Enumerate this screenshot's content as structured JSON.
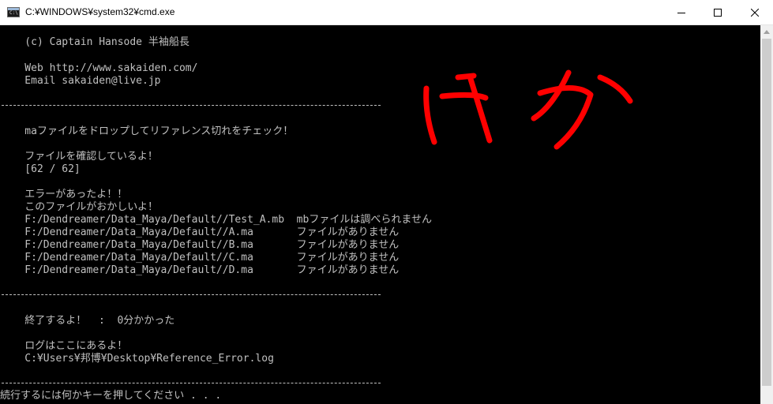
{
  "window": {
    "title": "C:¥WINDOWS¥system32¥cmd.exe",
    "icon_text": "C:\\",
    "icon": "console-icon",
    "controls": {
      "minimize": "minimize-icon",
      "maximize": "maximize-icon",
      "close": "close-icon"
    }
  },
  "console": {
    "lines": [
      "    (c) Captain Hansode 半袖船長",
      "",
      "    Web http://www.sakaiden.com/",
      "    Email sakaiden@live.jp",
      "    maファイルをドロップしてリファレンス切れをチェック！",
      "    ファイルを確認しているよ！",
      "    [62 / 62]",
      "    エラーがあったよ！！",
      "    このファイルがおかしいよ！",
      "    F:/Dendreamer/Data_Maya/Default//Test_A.mb  mbファイルは調べられません",
      "    F:/Dendreamer/Data_Maya/Default//A.ma       ファイルがありません",
      "    F:/Dendreamer/Data_Maya/Default//B.ma       ファイルがありません",
      "    F:/Dendreamer/Data_Maya/Default//C.ma       ファイルがありません",
      "    F:/Dendreamer/Data_Maya/Default//D.ma       ファイルがありません",
      "    終了するよ！  :  0分かかった",
      "    ログはここにあるよ！",
      "    C:¥Users¥邦博¥Desktop¥Reference_Error.log",
      "続行するには何かキーを押してください . . ."
    ]
  },
  "annotation": {
    "color": "#ff0000"
  },
  "colors": {
    "console_bg": "#000000",
    "console_text": "#c0c0c0",
    "titlebar_bg": "#ffffff"
  }
}
